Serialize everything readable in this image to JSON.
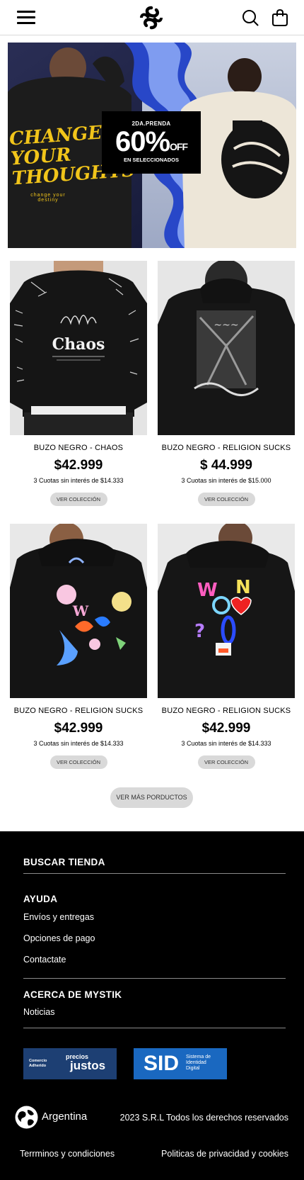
{
  "header": {
    "menu_icon": "hamburger-menu-icon",
    "logo_icon": "mystik-logo-icon",
    "search_icon": "search-icon",
    "cart_icon": "shopping-bag-icon"
  },
  "banner": {
    "left_text": "CHANGE YOUR THOUGHTS",
    "left_subtext": "change your destiny",
    "promo_top": "2DA.PRENDA",
    "promo_pct": "60%",
    "promo_off": "OFF",
    "promo_bottom": "EN SELECCIONADOS"
  },
  "products": [
    {
      "name": "BUZO NEGRO - CHAOS",
      "price": "$42.999",
      "cuotas": "3 Cuotas sin interés de $14.333",
      "button": "VER COLECCIÓN",
      "print_text": "Chaos"
    },
    {
      "name": "BUZO NEGRO - RELIGION SUCKS",
      "price": "$ 44.999",
      "cuotas": "3 Cuotas sin interés de $15.000",
      "button": "VER COLECCIÓN"
    },
    {
      "name": "BUZO NEGRO - RELIGION SUCKS",
      "price": "$42.999",
      "cuotas": "3 Cuotas sin interés de $14.333",
      "button": "VER COLECCIÓN"
    },
    {
      "name": "BUZO NEGRO - RELIGION SUCKS",
      "price": "$42.999",
      "cuotas": "3 Cuotas sin interés de $14.333",
      "button": "VER COLECCIÓN"
    }
  ],
  "more_button": "VER MÁS PORDUCTOS",
  "footer": {
    "buscar": "BUSCAR TIENDA",
    "ayuda": "AYUDA",
    "ayuda_links": [
      "Envíos y entregas",
      "Opciones de pago",
      "Contactate"
    ],
    "acerca": "ACERCA DE MYSTIK",
    "acerca_links": [
      "Noticias"
    ],
    "badge_precios": {
      "small": "Comercio Adherido",
      "top": "precios",
      "big": "justos"
    },
    "badge_sid": {
      "big": "SID",
      "small": [
        "Sistema de",
        "Identidad",
        "Digital"
      ]
    },
    "country": "Argentina",
    "rights": "2023 S.R.L Todos los derechos reservados",
    "terms": "Terrminos y condiciones",
    "privacy": "Politicas de privacidad y cookies"
  },
  "colors": {
    "accent_yellow": "#f2c51a",
    "footer_bg": "#000000",
    "button_gray": "#d9d9d9"
  }
}
